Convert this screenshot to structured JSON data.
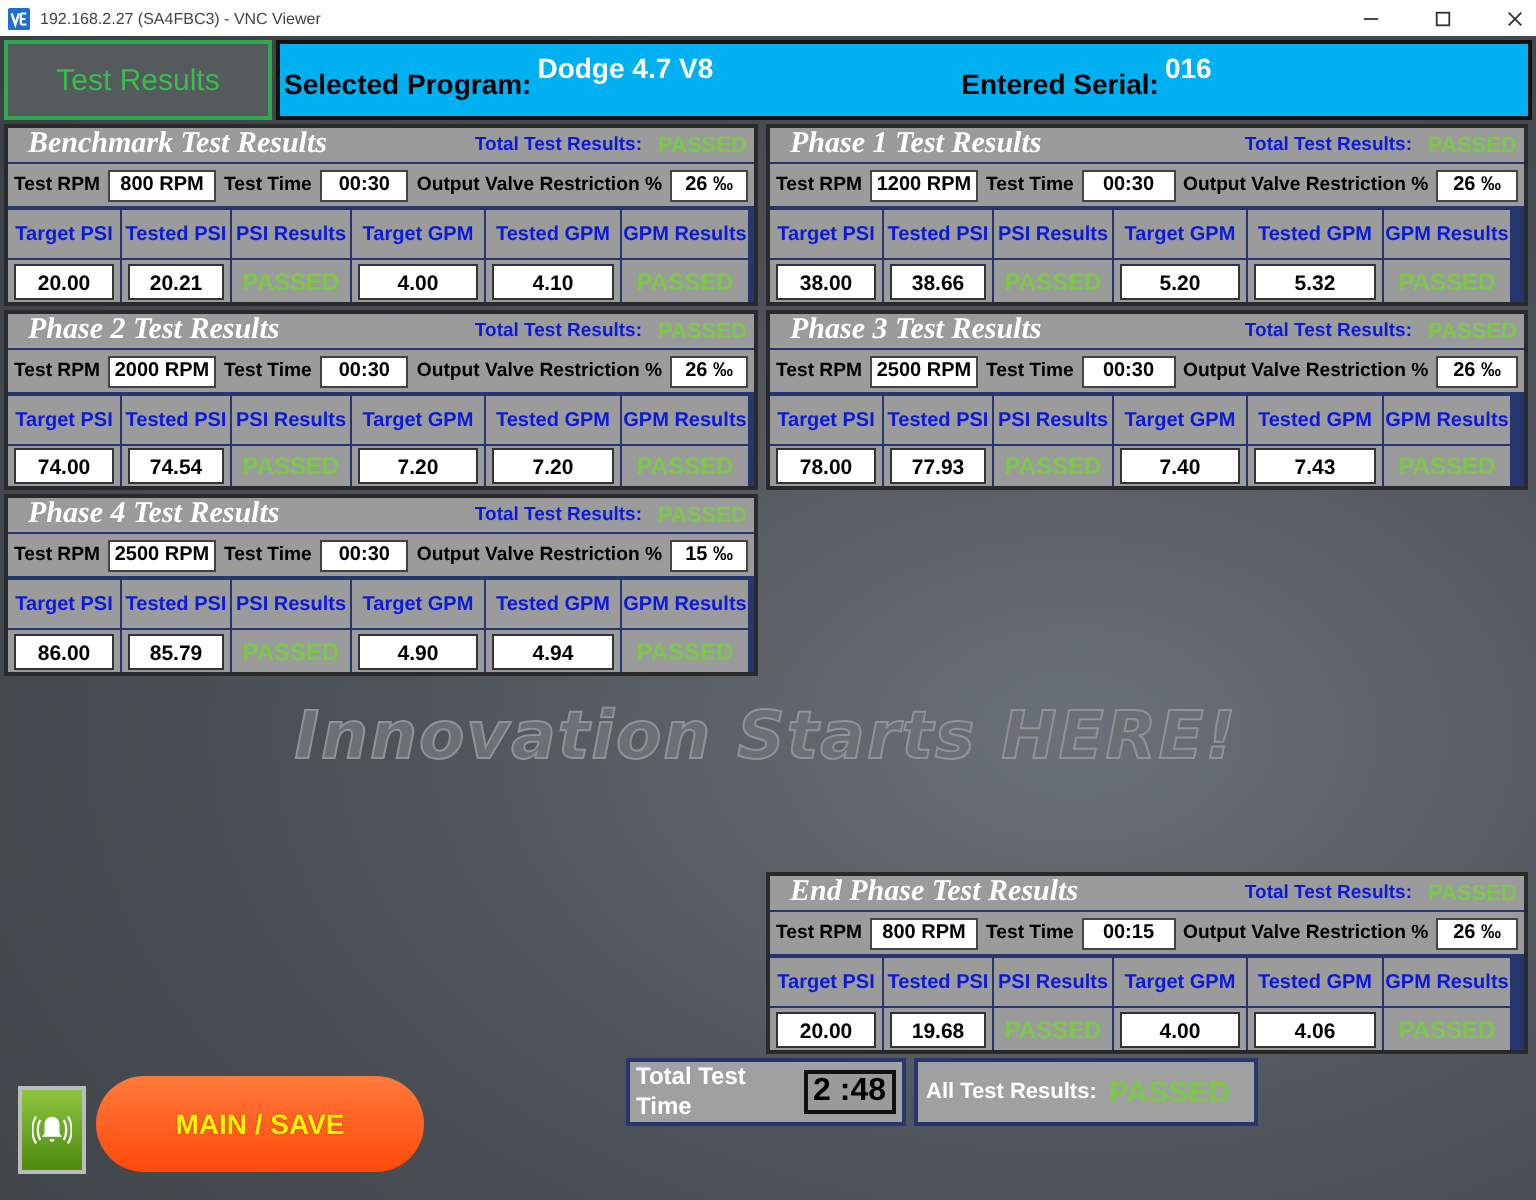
{
  "window": {
    "title": "192.168.2.27 (SA4FBC3) - VNC Viewer"
  },
  "header": {
    "tab": "Test Results",
    "program_label": "Selected Program:",
    "program": "Dodge 4.7 V8",
    "serial_label": "Entered Serial:",
    "serial": "016"
  },
  "panels": [
    {
      "title": "Benchmark Test Results",
      "total_label": "Total Test Results:",
      "total_result": "PASSED",
      "rpm_label": "Test RPM",
      "rpm": "800 RPM",
      "time_label": "Test Time",
      "time": "00:30",
      "restriction_label": "Output Valve Restriction %",
      "restriction": "26 ‰",
      "columns": [
        "Target PSI",
        "Tested PSI",
        "PSI Results",
        "Target GPM",
        "Tested GPM",
        "GPM Results"
      ],
      "values": [
        "20.00",
        "20.21",
        "PASSED",
        "4.00",
        "4.10",
        "PASSED"
      ]
    },
    {
      "title": "Phase 1 Test Results",
      "total_label": "Total Test Results:",
      "total_result": "PASSED",
      "rpm_label": "Test RPM",
      "rpm": "1200 RPM",
      "time_label": "Test Time",
      "time": "00:30",
      "restriction_label": "Output Valve Restriction %",
      "restriction": "26 ‰",
      "columns": [
        "Target PSI",
        "Tested PSI",
        "PSI Results",
        "Target GPM",
        "Tested GPM",
        "GPM Results"
      ],
      "values": [
        "38.00",
        "38.66",
        "PASSED",
        "5.20",
        "5.32",
        "PASSED"
      ]
    },
    {
      "title": "Phase 2 Test Results",
      "total_label": "Total Test Results:",
      "total_result": "PASSED",
      "rpm_label": "Test RPM",
      "rpm": "2000 RPM",
      "time_label": "Test Time",
      "time": "00:30",
      "restriction_label": "Output Valve Restriction %",
      "restriction": "26 ‰",
      "columns": [
        "Target PSI",
        "Tested PSI",
        "PSI Results",
        "Target GPM",
        "Tested GPM",
        "GPM Results"
      ],
      "values": [
        "74.00",
        "74.54",
        "PASSED",
        "7.20",
        "7.20",
        "PASSED"
      ]
    },
    {
      "title": "Phase 3 Test Results",
      "total_label": "Total Test Results:",
      "total_result": "PASSED",
      "rpm_label": "Test RPM",
      "rpm": "2500 RPM",
      "time_label": "Test Time",
      "time": "00:30",
      "restriction_label": "Output Valve Restriction %",
      "restriction": "26 ‰",
      "columns": [
        "Target PSI",
        "Tested PSI",
        "PSI Results",
        "Target GPM",
        "Tested GPM",
        "GPM Results"
      ],
      "values": [
        "78.00",
        "77.93",
        "PASSED",
        "7.40",
        "7.43",
        "PASSED"
      ]
    },
    {
      "title": "Phase 4 Test Results",
      "total_label": "Total Test Results:",
      "total_result": "PASSED",
      "rpm_label": "Test RPM",
      "rpm": "2500 RPM",
      "time_label": "Test Time",
      "time": "00:30",
      "restriction_label": "Output Valve Restriction %",
      "restriction": "15 ‰",
      "columns": [
        "Target PSI",
        "Tested PSI",
        "PSI Results",
        "Target GPM",
        "Tested GPM",
        "GPM Results"
      ],
      "values": [
        "86.00",
        "85.79",
        "PASSED",
        "4.90",
        "4.94",
        "PASSED"
      ]
    }
  ],
  "slogan": "Innovation Starts HERE!",
  "end_panel": {
    "title": "End Phase Test Results",
    "total_label": "Total Test Results:",
    "total_result": "PASSED",
    "rpm_label": "Test RPM",
    "rpm": "800 RPM",
    "time_label": "Test Time",
    "time": "00:15",
    "restriction_label": "Output Valve Restriction %",
    "restriction": "26 ‰",
    "columns": [
      "Target PSI",
      "Tested PSI",
      "PSI Results",
      "Target GPM",
      "Tested GPM",
      "GPM Results"
    ],
    "values": [
      "20.00",
      "19.68",
      "PASSED",
      "4.00",
      "4.06",
      "PASSED"
    ]
  },
  "footer": {
    "main_button": "MAIN / SAVE",
    "total_time_label": "Total Test Time",
    "total_time": "2 :48",
    "all_results_label": "All Test Results:",
    "all_results": "PASSED"
  }
}
